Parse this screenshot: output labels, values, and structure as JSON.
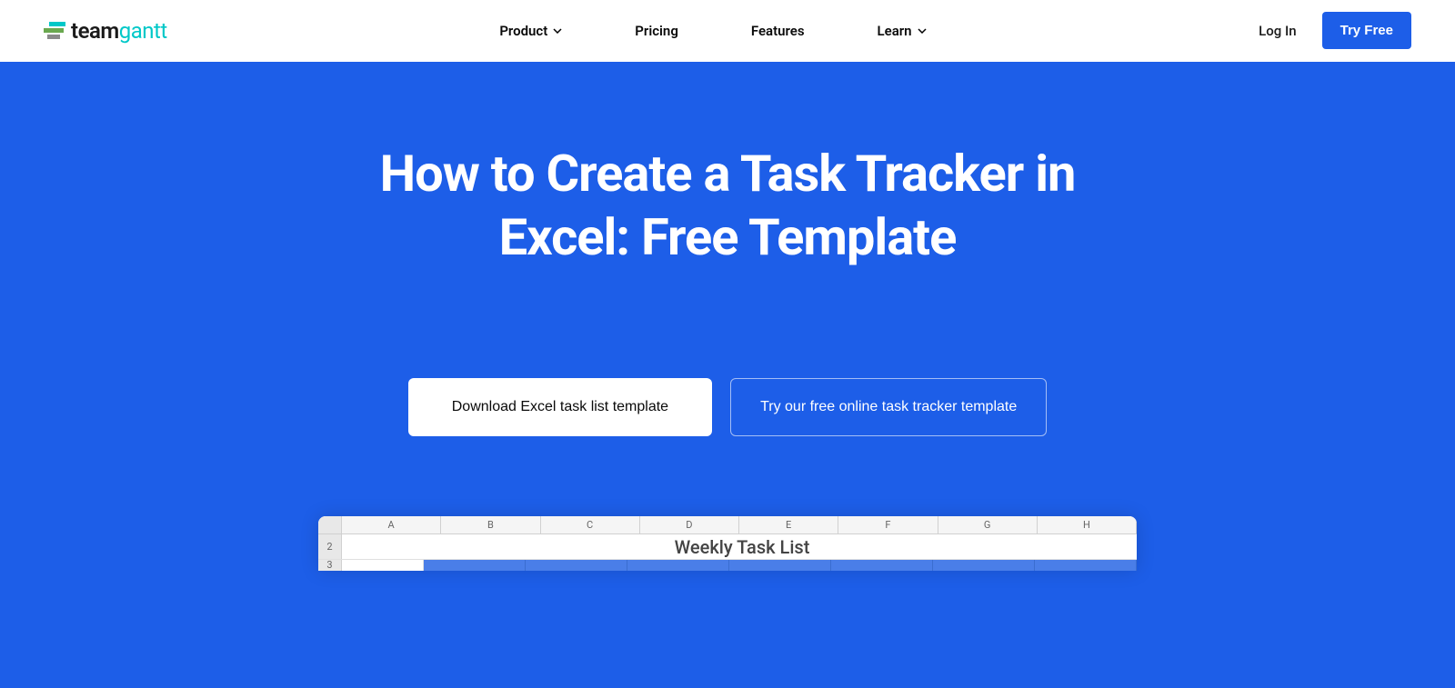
{
  "header": {
    "logo_team": "team",
    "logo_gantt": "gantt",
    "nav": {
      "product": "Product",
      "pricing": "Pricing",
      "features": "Features",
      "learn": "Learn"
    },
    "login": "Log In",
    "try_free": "Try Free"
  },
  "hero": {
    "title": "How to Create a Task Tracker in Excel: Free Template",
    "btn_download": "Download Excel task list template",
    "btn_try": "Try our free online task tracker template"
  },
  "spreadsheet": {
    "columns": [
      "A",
      "B",
      "C",
      "D",
      "E",
      "F",
      "G",
      "H"
    ],
    "row2_num": "2",
    "row2_title": "Weekly Task List",
    "row3_num": "3"
  }
}
